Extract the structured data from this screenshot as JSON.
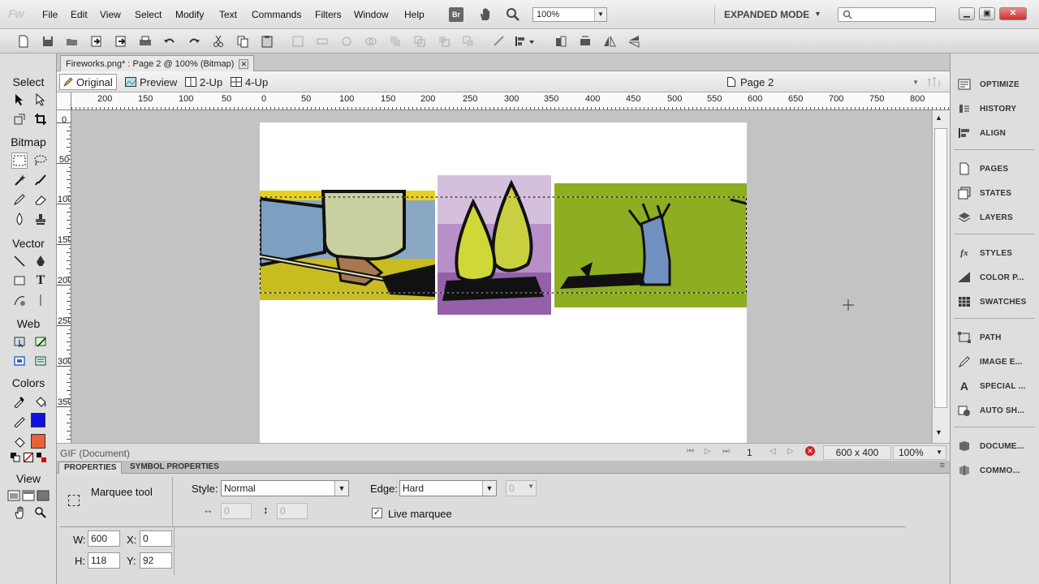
{
  "app": {
    "logo": "Fw"
  },
  "menu": [
    "File",
    "Edit",
    "View",
    "Select",
    "Modify",
    "Text",
    "Commands",
    "Filters",
    "Window",
    "Help"
  ],
  "topbar": {
    "bridge_label": "Br",
    "zoom": "100%",
    "mode": "EXPANDED MODE",
    "search_placeholder": ""
  },
  "document": {
    "tab_title": "Fireworks.png* : Page 2 @ 100% (Bitmap)"
  },
  "view_bar": {
    "original": "Original",
    "preview": "Preview",
    "two_up": "2-Up",
    "four_up": "4-Up",
    "page": "Page 2"
  },
  "tools": {
    "select": "Select",
    "bitmap": "Bitmap",
    "vector": "Vector",
    "web": "Web",
    "colors": "Colors",
    "view": "View"
  },
  "colors": {
    "stroke": "#1010dd",
    "fill": "#e8623c"
  },
  "ruler": {
    "top": [
      "200",
      "150",
      "100",
      "50",
      "0",
      "50",
      "100",
      "150",
      "200",
      "250",
      "300",
      "350",
      "400",
      "450",
      "500",
      "550",
      "600",
      "650",
      "700",
      "750",
      "800"
    ],
    "left": [
      "0",
      "50",
      "100",
      "150",
      "200",
      "250",
      "300",
      "350"
    ]
  },
  "status": {
    "doc_type": "GIF (Document)",
    "page_num": "1",
    "canvas_size": "600 x 400",
    "zoom": "100%"
  },
  "properties": {
    "tab_properties": "PROPERTIES",
    "tab_symbol": "SYMBOL PROPERTIES",
    "tool_name": "Marquee tool",
    "style_label": "Style:",
    "style_value": "Normal",
    "edge_label": "Edge:",
    "edge_value": "Hard",
    "edge_amount": "0",
    "fixed_w": "0",
    "fixed_h": "0",
    "live_marquee": "Live marquee",
    "w_label": "W:",
    "w": "600",
    "x_label": "X:",
    "x": "0",
    "h_label": "H:",
    "h": "118",
    "y_label": "Y:",
    "y": "92"
  },
  "panels": [
    "OPTIMIZE",
    "HISTORY",
    "ALIGN",
    "PAGES",
    "STATES",
    "LAYERS",
    "STYLES",
    "COLOR P...",
    "SWATCHES",
    "PATH",
    "IMAGE E...",
    "SPECIAL ...",
    "AUTO SH...",
    "DOCUME...",
    "COMMO..."
  ]
}
